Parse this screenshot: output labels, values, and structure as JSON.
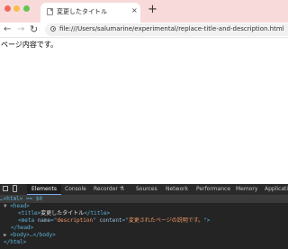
{
  "browser": {
    "tab": {
      "title": "変更したタイトル",
      "close_glyph": "×"
    },
    "new_tab_glyph": "+",
    "nav": {
      "back_glyph": "←",
      "forward_glyph": "→",
      "reload_glyph": "↻"
    },
    "address_bar": {
      "url": "file:///Users/salumarine/experimental/replace-title-and-description.html"
    },
    "traffic_lights": {
      "close": "#ee6a5f",
      "minimize": "#f5be4f",
      "zoom": "#62c554"
    },
    "tabstrip_color": "#f8dada"
  },
  "page": {
    "body_text": "ページ内容です。"
  },
  "devtools": {
    "tabs": [
      {
        "label": "Elements",
        "active": true
      },
      {
        "label": "Console"
      },
      {
        "label": "Recorder ⚗"
      },
      {
        "label": "Sources"
      },
      {
        "label": "Network"
      },
      {
        "label": "Performance"
      },
      {
        "label": "Memory"
      },
      {
        "label": "Application"
      }
    ],
    "dom": {
      "line0": {
        "text": "…<html> == $0"
      },
      "line1": {
        "tri": "▼",
        "open": "<head>"
      },
      "line2": {
        "open": "<title>",
        "text": "変更したタイトル",
        "close": "</title>"
      },
      "line3": {
        "open": "<meta ",
        "attr1": "name",
        "eq1": "=\"",
        "val1": "description",
        "mid": "\" ",
        "attr2": "content",
        "eq2": "=\"",
        "val2": "変更されたページの説明です。",
        "close": "\">"
      },
      "line4": {
        "close": "</head>"
      },
      "line5": {
        "tri": "▶",
        "open": "<body>",
        "ell": "…",
        "close": "</body>"
      },
      "line6": {
        "close": "</html>"
      }
    }
  }
}
